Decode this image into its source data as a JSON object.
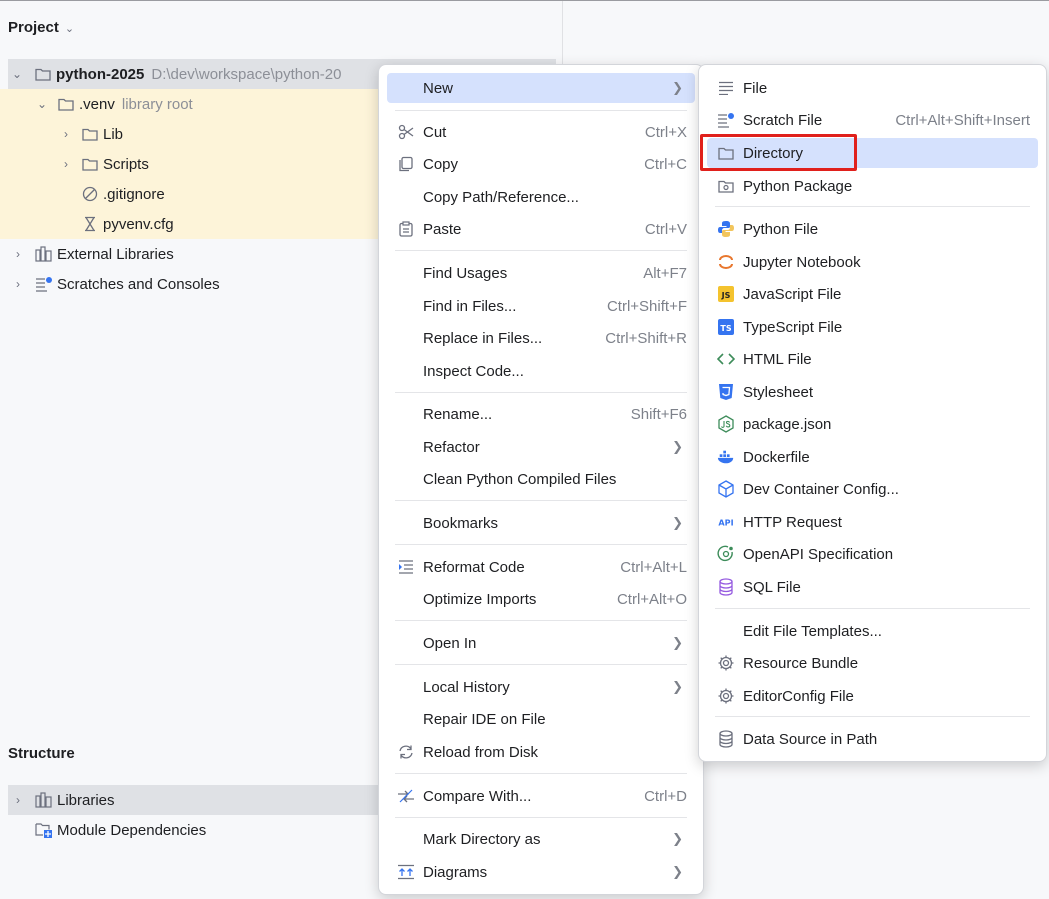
{
  "project": {
    "title": "Project",
    "root_name": "python-2025",
    "root_path": "D:\\dev\\workspace\\python-20",
    "venv_name": ".venv",
    "venv_note": "library root",
    "items": [
      "Lib",
      "Scripts",
      ".gitignore",
      "pyvenv.cfg"
    ],
    "external_libraries": "External Libraries",
    "scratches": "Scratches and Consoles"
  },
  "structure": {
    "title": "Structure",
    "libraries": "Libraries",
    "module_dependencies": "Module Dependencies"
  },
  "context_menu": [
    {
      "label": "New",
      "submenu": true,
      "active": true,
      "icon": "none"
    },
    {
      "label": "Cut",
      "shortcut": "Ctrl+X",
      "icon": "scissors-icon"
    },
    {
      "label": "Copy",
      "shortcut": "Ctrl+C",
      "icon": "copy-icon"
    },
    {
      "label": "Copy Path/Reference...",
      "icon": "none"
    },
    {
      "label": "Paste",
      "shortcut": "Ctrl+V",
      "icon": "paste-icon"
    },
    {
      "label": "Find Usages",
      "shortcut": "Alt+F7"
    },
    {
      "label": "Find in Files...",
      "shortcut": "Ctrl+Shift+F"
    },
    {
      "label": "Replace in Files...",
      "shortcut": "Ctrl+Shift+R"
    },
    {
      "label": "Inspect Code..."
    },
    {
      "label": "Rename...",
      "shortcut": "Shift+F6"
    },
    {
      "label": "Refactor",
      "submenu": true
    },
    {
      "label": "Clean Python Compiled Files"
    },
    {
      "label": "Bookmarks",
      "submenu": true
    },
    {
      "label": "Reformat Code",
      "shortcut": "Ctrl+Alt+L",
      "icon": "reformat-icon"
    },
    {
      "label": "Optimize Imports",
      "shortcut": "Ctrl+Alt+O"
    },
    {
      "label": "Open In",
      "submenu": true
    },
    {
      "label": "Local History",
      "submenu": true
    },
    {
      "label": "Repair IDE on File"
    },
    {
      "label": "Reload from Disk",
      "icon": "reload-icon"
    },
    {
      "label": "Compare With...",
      "shortcut": "Ctrl+D",
      "icon": "compare-icon"
    },
    {
      "label": "Mark Directory as",
      "submenu": true
    },
    {
      "label": "Diagrams",
      "submenu": true,
      "icon": "diagram-icon"
    }
  ],
  "new_submenu": [
    {
      "label": "File",
      "icon": "file-icon"
    },
    {
      "label": "Scratch File",
      "shortcut": "Ctrl+Alt+Shift+Insert",
      "icon": "scratch-file-icon"
    },
    {
      "label": "Directory",
      "icon": "folder-icon",
      "active": true,
      "annotated": true
    },
    {
      "label": "Python Package",
      "icon": "package-icon"
    },
    {
      "label": "Python File",
      "icon": "python-icon"
    },
    {
      "label": "Jupyter Notebook",
      "icon": "jupyter-icon"
    },
    {
      "label": "JavaScript File",
      "icon": "javascript-icon"
    },
    {
      "label": "TypeScript File",
      "icon": "typescript-icon"
    },
    {
      "label": "HTML File",
      "icon": "html-icon"
    },
    {
      "label": "Stylesheet",
      "icon": "css-icon"
    },
    {
      "label": "package.json",
      "icon": "nodejs-icon"
    },
    {
      "label": "Dockerfile",
      "icon": "docker-icon"
    },
    {
      "label": "Dev Container Config...",
      "icon": "cube-icon"
    },
    {
      "label": "HTTP Request",
      "icon": "api-icon"
    },
    {
      "label": "OpenAPI Specification",
      "icon": "openapi-icon"
    },
    {
      "label": "SQL File",
      "icon": "database-icon"
    },
    {
      "label": "Edit File Templates...",
      "icon": "none"
    },
    {
      "label": "Resource Bundle",
      "icon": "gear-icon"
    },
    {
      "label": "EditorConfig File",
      "icon": "gear-icon"
    },
    {
      "label": "Data Source in Path",
      "icon": "database-icon"
    }
  ],
  "icon_texts": {
    "js": "JS",
    "ts": "TS",
    "api": "API"
  },
  "colors": {
    "highlight_row": "#fdf4d9",
    "menu_active": "#d5e1fd",
    "annotation_red": "#e0201c"
  }
}
